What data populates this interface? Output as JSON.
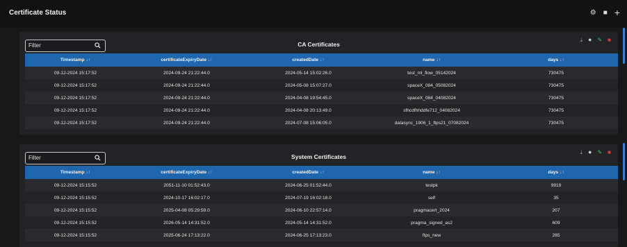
{
  "page": {
    "title": "Certificate Status",
    "actions": [
      {
        "name": "settings",
        "glyph": "⚙"
      },
      {
        "name": "delete",
        "glyph": "■"
      },
      {
        "name": "add",
        "glyph": "+"
      }
    ]
  },
  "sort_glyph": "↓↑",
  "ca_panel": {
    "title": "CA Certificates",
    "filter_placeholder": "Filter",
    "columns": [
      "Timestamp",
      "certificateExpiryDate",
      "createdDate",
      "name",
      "days"
    ],
    "rows": [
      [
        "09-12-2024 15:17:52",
        "2024-09-24 21:22:44.0",
        "2024-05-14 15:02:26.0",
        "test_ml_flow_05142024",
        "730475"
      ],
      [
        "09-12-2024 15:17:52",
        "2024-09-24 21:22:44.0",
        "2024-05-08 15:07:27.0",
        "spaceX_084_05082024",
        "730475"
      ],
      [
        "09-12-2024 15:17:52",
        "2024-09-24 21:22:44.0",
        "2024-04-08 19:54:45.0",
        "spaceX_084_04082024",
        "730475"
      ],
      [
        "09-12-2024 15:17:52",
        "2024-09-24 21:22:44.0",
        "2024-04-08 20:13:49.0",
        "sfhcdfhhddfe712_04082024",
        "730475"
      ],
      [
        "09-12-2024 15:17:52",
        "2024-09-24 21:22:44.0",
        "2024-07-08 15:06:05.0",
        "datasync_1906_1_ftps21_07082024",
        "730475"
      ]
    ]
  },
  "system_panel": {
    "title": "System Certificates",
    "filter_placeholder": "Filter",
    "columns": [
      "Timestamp",
      "certificateExpiryDate",
      "createdDate",
      "name",
      "days"
    ],
    "rows": [
      [
        "09-12-2024 15:15:52",
        "2051-11-10 01:52:43.0",
        "2024-06-25 01:52:44.0",
        "testpk",
        "9919"
      ],
      [
        "09-12-2024 15:15:52",
        "2024-10-17 16:02:17.0",
        "2024-07-19 16:02:18.0",
        "self",
        "35"
      ],
      [
        "09-12-2024 15:15:52",
        "2025-04-08 05:29:59.0",
        "2024-06-10 22:57:14.0",
        "pragmacert_2024",
        "207"
      ],
      [
        "09-12-2024 15:15:52",
        "2026-05-14 14:31:52.0",
        "2024-05-14 14:31:52.0",
        "pragma_signed_as2",
        "609"
      ],
      [
        "09-12-2024 15:15:52",
        "2025-06-24 17:13:22.0",
        "2024-06-25 17:13:23.0",
        "ftps_new",
        "285"
      ]
    ]
  },
  "panel_actions": [
    {
      "name": "download",
      "glyph": "⤓"
    },
    {
      "name": "view",
      "glyph": "●"
    },
    {
      "name": "edit",
      "glyph": "✎"
    },
    {
      "name": "delete",
      "glyph": "■"
    }
  ],
  "colors": {
    "header_blue": "#1f66ad",
    "edit_green": "#3fbf62",
    "delete_red": "#e53935",
    "scrollbar_blue": "#3b7dd8"
  }
}
